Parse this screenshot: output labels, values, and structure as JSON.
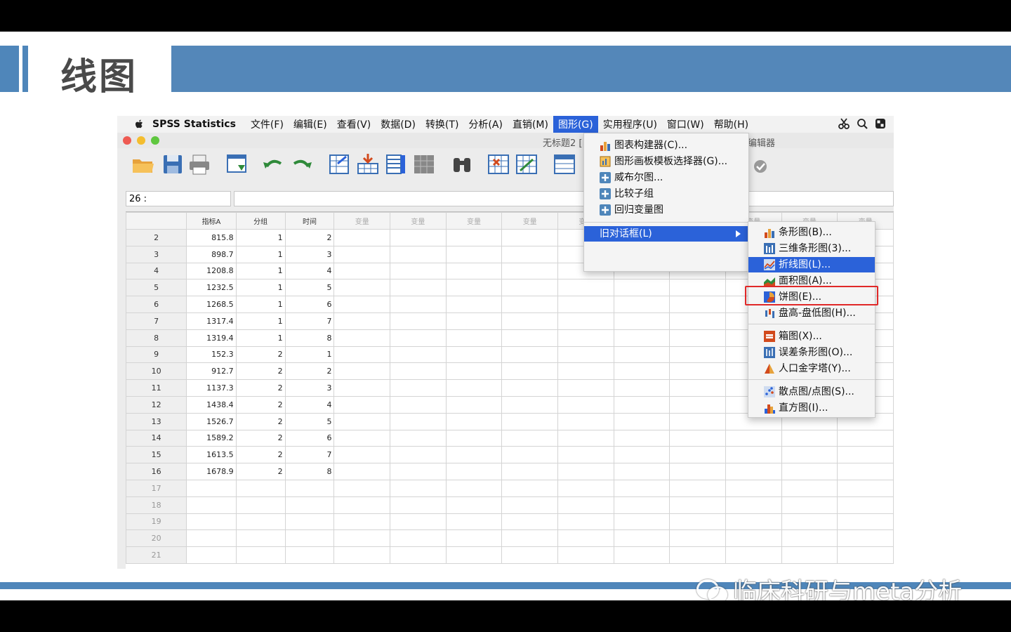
{
  "slide": {
    "title": "线图",
    "watermark": "临床科研与meta分析"
  },
  "menubar": {
    "app_name": "SPSS Statistics",
    "items": [
      "文件(F)",
      "编辑(E)",
      "查看(V)",
      "数据(D)",
      "转换(T)",
      "分析(A)",
      "直销(M)",
      "图形(G)",
      "实用程序(U)",
      "窗口(W)",
      "帮助(H)"
    ],
    "active": "图形(G)"
  },
  "window": {
    "title_left": "无标题2 [",
    "title_right": "编辑器"
  },
  "toolbar": {
    "icons": [
      "open-folder-icon",
      "save-icon",
      "print-icon",
      "recall-dialog-icon",
      "undo-icon",
      "redo-icon",
      "goto-case-icon",
      "goto-variable-icon",
      "variables-icon",
      "run-descriptives-icon",
      "find-icon",
      "insert-cases-icon",
      "insert-variable-icon",
      "split-file-icon",
      "spell-check-icon"
    ]
  },
  "cell_editor": {
    "ref": "26 :",
    "value": ""
  },
  "grid": {
    "columns": [
      "指标A",
      "分组",
      "时间",
      "变量",
      "变量",
      "变量",
      "变量",
      "变量",
      "变量",
      "变量",
      "变量",
      "变量",
      "变量"
    ],
    "rows": [
      {
        "n": "2",
        "a": "815.8",
        "g": "1",
        "t": "2"
      },
      {
        "n": "3",
        "a": "898.7",
        "g": "1",
        "t": "3"
      },
      {
        "n": "4",
        "a": "1208.8",
        "g": "1",
        "t": "4"
      },
      {
        "n": "5",
        "a": "1232.5",
        "g": "1",
        "t": "5"
      },
      {
        "n": "6",
        "a": "1268.5",
        "g": "1",
        "t": "6"
      },
      {
        "n": "7",
        "a": "1317.4",
        "g": "1",
        "t": "7"
      },
      {
        "n": "8",
        "a": "1319.4",
        "g": "1",
        "t": "8"
      },
      {
        "n": "9",
        "a": "152.3",
        "g": "2",
        "t": "1"
      },
      {
        "n": "10",
        "a": "912.7",
        "g": "2",
        "t": "2"
      },
      {
        "n": "11",
        "a": "1137.3",
        "g": "2",
        "t": "3"
      },
      {
        "n": "12",
        "a": "1438.4",
        "g": "2",
        "t": "4"
      },
      {
        "n": "13",
        "a": "1526.7",
        "g": "2",
        "t": "5"
      },
      {
        "n": "14",
        "a": "1589.2",
        "g": "2",
        "t": "6"
      },
      {
        "n": "15",
        "a": "1613.5",
        "g": "2",
        "t": "7"
      },
      {
        "n": "16",
        "a": "1678.9",
        "g": "2",
        "t": "8"
      },
      {
        "n": "17",
        "a": "",
        "g": "",
        "t": ""
      },
      {
        "n": "18",
        "a": "",
        "g": "",
        "t": ""
      },
      {
        "n": "19",
        "a": "",
        "g": "",
        "t": ""
      },
      {
        "n": "20",
        "a": "",
        "g": "",
        "t": ""
      },
      {
        "n": "21",
        "a": "",
        "g": "",
        "t": ""
      }
    ]
  },
  "graphs_menu": {
    "items": [
      {
        "label": "图表构建器(C)...",
        "icon": "chart-builder-icon"
      },
      {
        "label": "图形画板模板选择器(G)...",
        "icon": "template-chooser-icon"
      },
      {
        "label": "威布尔图...",
        "icon": "plus-icon"
      },
      {
        "label": "比较子组",
        "icon": "plus-icon"
      },
      {
        "label": "回归变量图",
        "icon": "plus-icon"
      }
    ],
    "legacy": "旧对话框(L)"
  },
  "legacy_submenu": {
    "items": [
      {
        "label": "条形图(B)...",
        "icon": "bar-chart-icon"
      },
      {
        "label": "三维条形图(3)...",
        "icon": "3d-bar-icon"
      },
      {
        "label": "折线图(L)...",
        "icon": "line-chart-icon"
      },
      {
        "label": "面积图(A)...",
        "icon": "area-chart-icon"
      },
      {
        "label": "饼图(E)...",
        "icon": "pie-chart-icon"
      },
      {
        "label": "盘高-盘低图(H)...",
        "icon": "high-low-icon"
      },
      {
        "label": "箱图(X)...",
        "icon": "boxplot-icon"
      },
      {
        "label": "误差条形图(O)...",
        "icon": "error-bar-icon"
      },
      {
        "label": "人口金字塔(Y)...",
        "icon": "pyramid-icon"
      },
      {
        "label": "散点图/点图(S)...",
        "icon": "scatter-icon"
      },
      {
        "label": "直方图(I)...",
        "icon": "histogram-icon"
      }
    ],
    "selected": "折线图(L)..."
  },
  "colors": {
    "accent": "#4f86ba",
    "selection": "#2b62d9",
    "highlight": "#e02828"
  }
}
